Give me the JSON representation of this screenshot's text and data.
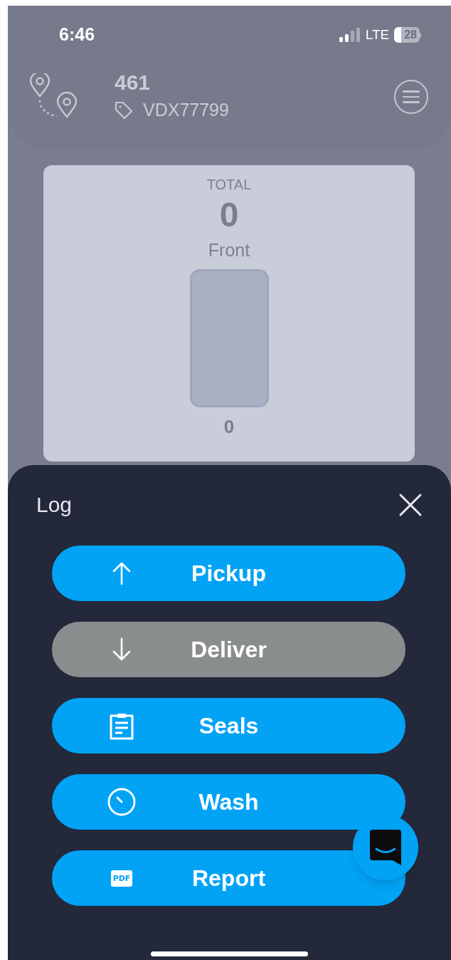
{
  "status_bar": {
    "time": "6:46",
    "network": "LTE",
    "battery": "28"
  },
  "header": {
    "title": "461",
    "tag": "VDX77799"
  },
  "summary": {
    "total_label": "TOTAL",
    "total": "0",
    "compartments": [
      {
        "label": "Front",
        "count": "0"
      }
    ]
  },
  "sheet": {
    "title": "Log",
    "buttons": [
      {
        "label": "Pickup",
        "disabled": false
      },
      {
        "label": "Deliver",
        "disabled": true
      },
      {
        "label": "Seals",
        "disabled": false
      },
      {
        "label": "Wash",
        "disabled": false
      },
      {
        "label": "Report",
        "disabled": false,
        "icon_text": "PDF"
      }
    ]
  }
}
